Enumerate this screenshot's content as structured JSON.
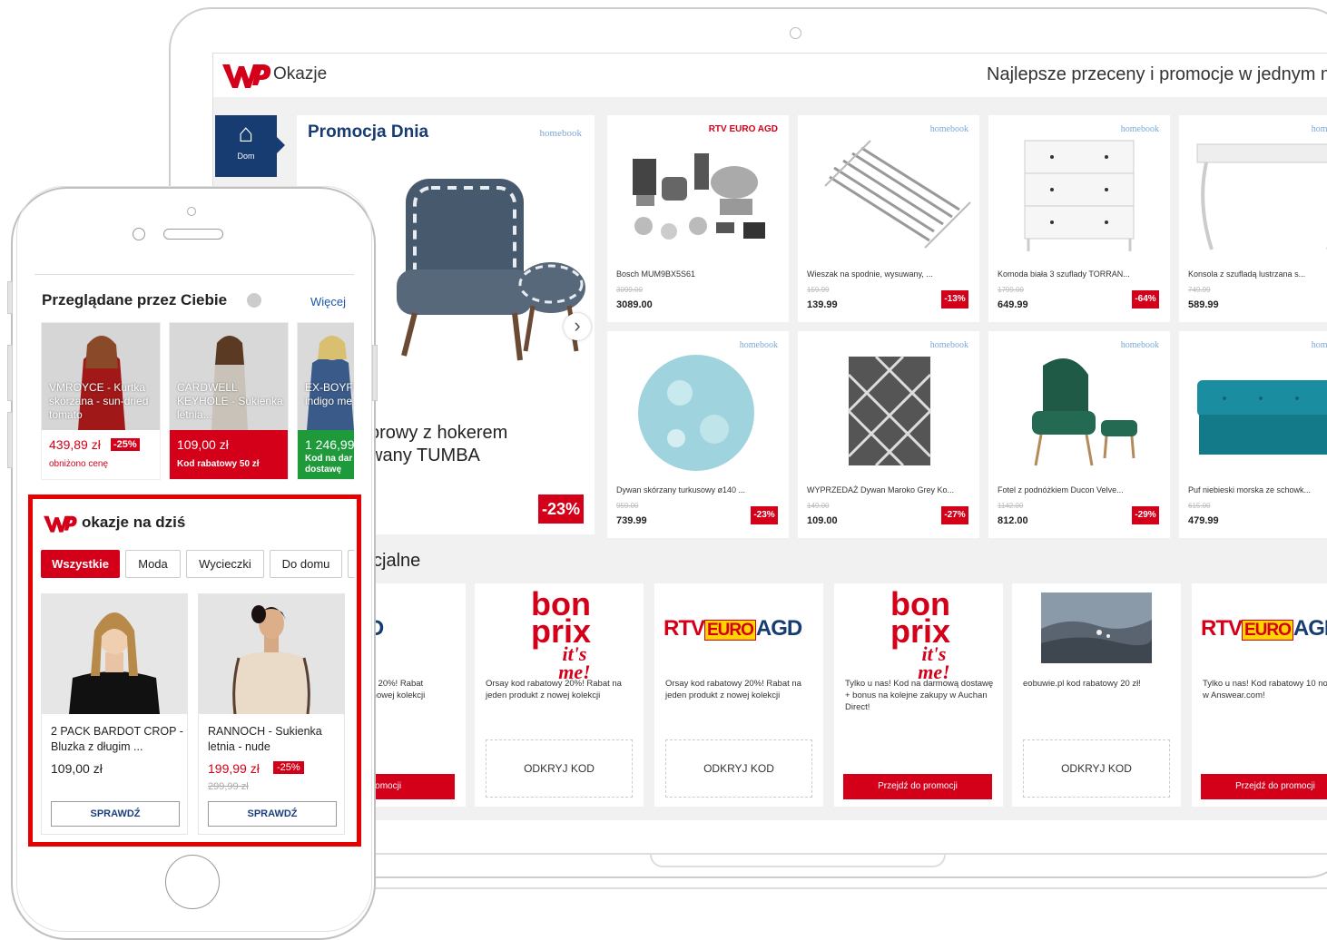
{
  "laptop": {
    "topbar": {
      "title": "Okazje",
      "slogan": "Najlepsze przeceny i promocje w jednym mie"
    },
    "sidebar": {
      "home_label": "Dom"
    },
    "promo": {
      "title": "Promocja Dnia",
      "brand": "homebook",
      "product_name_line1": "orowy z hokerem",
      "product_name_line2": "wany TUMBA",
      "discount": "-23%"
    },
    "products": [
      {
        "brand": "RTV EURO AGD",
        "name": "Bosch MUM9BX5S61",
        "old_price": "3099.00",
        "price": "3089.00",
        "discount": ""
      },
      {
        "brand": "homebook",
        "name": "Wieszak na spodnie, wysuwany, ...",
        "old_price": "159.99",
        "price": "139.99",
        "discount": "-13%"
      },
      {
        "brand": "homebook",
        "name": "Komoda biała 3 szuflady TORRAN...",
        "old_price": "1799.00",
        "price": "649.99",
        "discount": "-64%"
      },
      {
        "brand": "homebook",
        "name": "Konsola z szufladą lustrzana s...",
        "old_price": "749.99",
        "price": "589.99",
        "discount": ""
      },
      {
        "brand": "homebook",
        "name": "Dywan skórzany turkusowy ø140 ...",
        "old_price": "959.00",
        "price": "739.99",
        "discount": "-23%"
      },
      {
        "brand": "homebook",
        "name": "WYPRZEDAŻ Dywan Maroko Grey Ko...",
        "old_price": "149.00",
        "price": "109.00",
        "discount": "-27%"
      },
      {
        "brand": "homebook",
        "name": "Fotel z podnóżkiem Ducon Velve...",
        "old_price": "1142.00",
        "price": "812.00",
        "discount": "-29%"
      },
      {
        "brand": "homebook",
        "name": "Puf niebieski morska ze schowk...",
        "old_price": "615.00",
        "price": "479.99",
        "discount": ""
      }
    ],
    "section_title": "cjalne",
    "coupons": [
      {
        "logo": "RTV EURO AGD",
        "desc": "owy 20%! Rabat\nt z nowej kolekcji",
        "button": "o promocji"
      },
      {
        "logo": "bonprix",
        "desc": "Orsay kod rabatowy 20%! Rabat na jeden produkt z nowej kolekcji",
        "button": "ODKRYJ KOD"
      },
      {
        "logo": "RTV EURO AGD",
        "desc": "Orsay kod rabatowy 20%! Rabat na jeden produkt z nowej kolekcji",
        "button": "ODKRYJ KOD"
      },
      {
        "logo": "bonprix",
        "desc": "Tylko u nas! Kod na darmową dostawę + bonus na kolejne zakupy w Auchan Direct!",
        "button": "Przejdź do promocji"
      },
      {
        "logo": "photo",
        "desc": "eobuwie.pl kod rabatowy 20 zł!",
        "button": "ODKRYJ KOD"
      },
      {
        "logo": "RTV EURO AGD",
        "desc": "Tylko u nas! Kod rabatowy 10 nowości w Answear.com!",
        "button": "Przejdź do promocji"
      }
    ],
    "logo_text": {
      "rtv": "RTV",
      "euro": "EURO",
      "agd": "AGD",
      "bon": "bon",
      "prix": "prix",
      "itsme": "it's me!"
    }
  },
  "phone": {
    "viewed": {
      "title": "Przeglądane przez Ciebie",
      "more": "Więcej",
      "items": [
        {
          "caption": "VMROYCE - Kurtka skórzana - sun-dried tomato",
          "price": "439,89 zł",
          "discount": "-25%",
          "sub": "obniżono cenę"
        },
        {
          "caption": "CARDWELL KEYHOLE - Sukienka letnia...",
          "price": "109,00 zł",
          "discount": "",
          "sub": "Kod rabatowy 50 zł"
        },
        {
          "caption": "EX-BOYFR Kurtka jea indigo me",
          "price": "1 246,99",
          "discount": "",
          "sub": "Kod na dar dostawę"
        }
      ]
    },
    "deals": {
      "title": "okazje na dziś",
      "chips": [
        "Wszystkie",
        "Moda",
        "Wycieczki",
        "Do domu"
      ],
      "items": [
        {
          "name": "2 PACK BARDOT CROP - Bluzka z długim ...",
          "price": "109,00 zł",
          "discount": "",
          "old_price": "",
          "button": "SPRAWDŹ"
        },
        {
          "name": "RANNOCH - Sukienka letnia - nude",
          "price": "199,99 zł",
          "discount": "-25%",
          "old_price": "299,99 zł",
          "button": "SPRAWDŹ"
        }
      ]
    }
  },
  "colors": {
    "brand_red": "#d4001a",
    "navy": "#173c72",
    "highlight_border": "#e60000"
  }
}
